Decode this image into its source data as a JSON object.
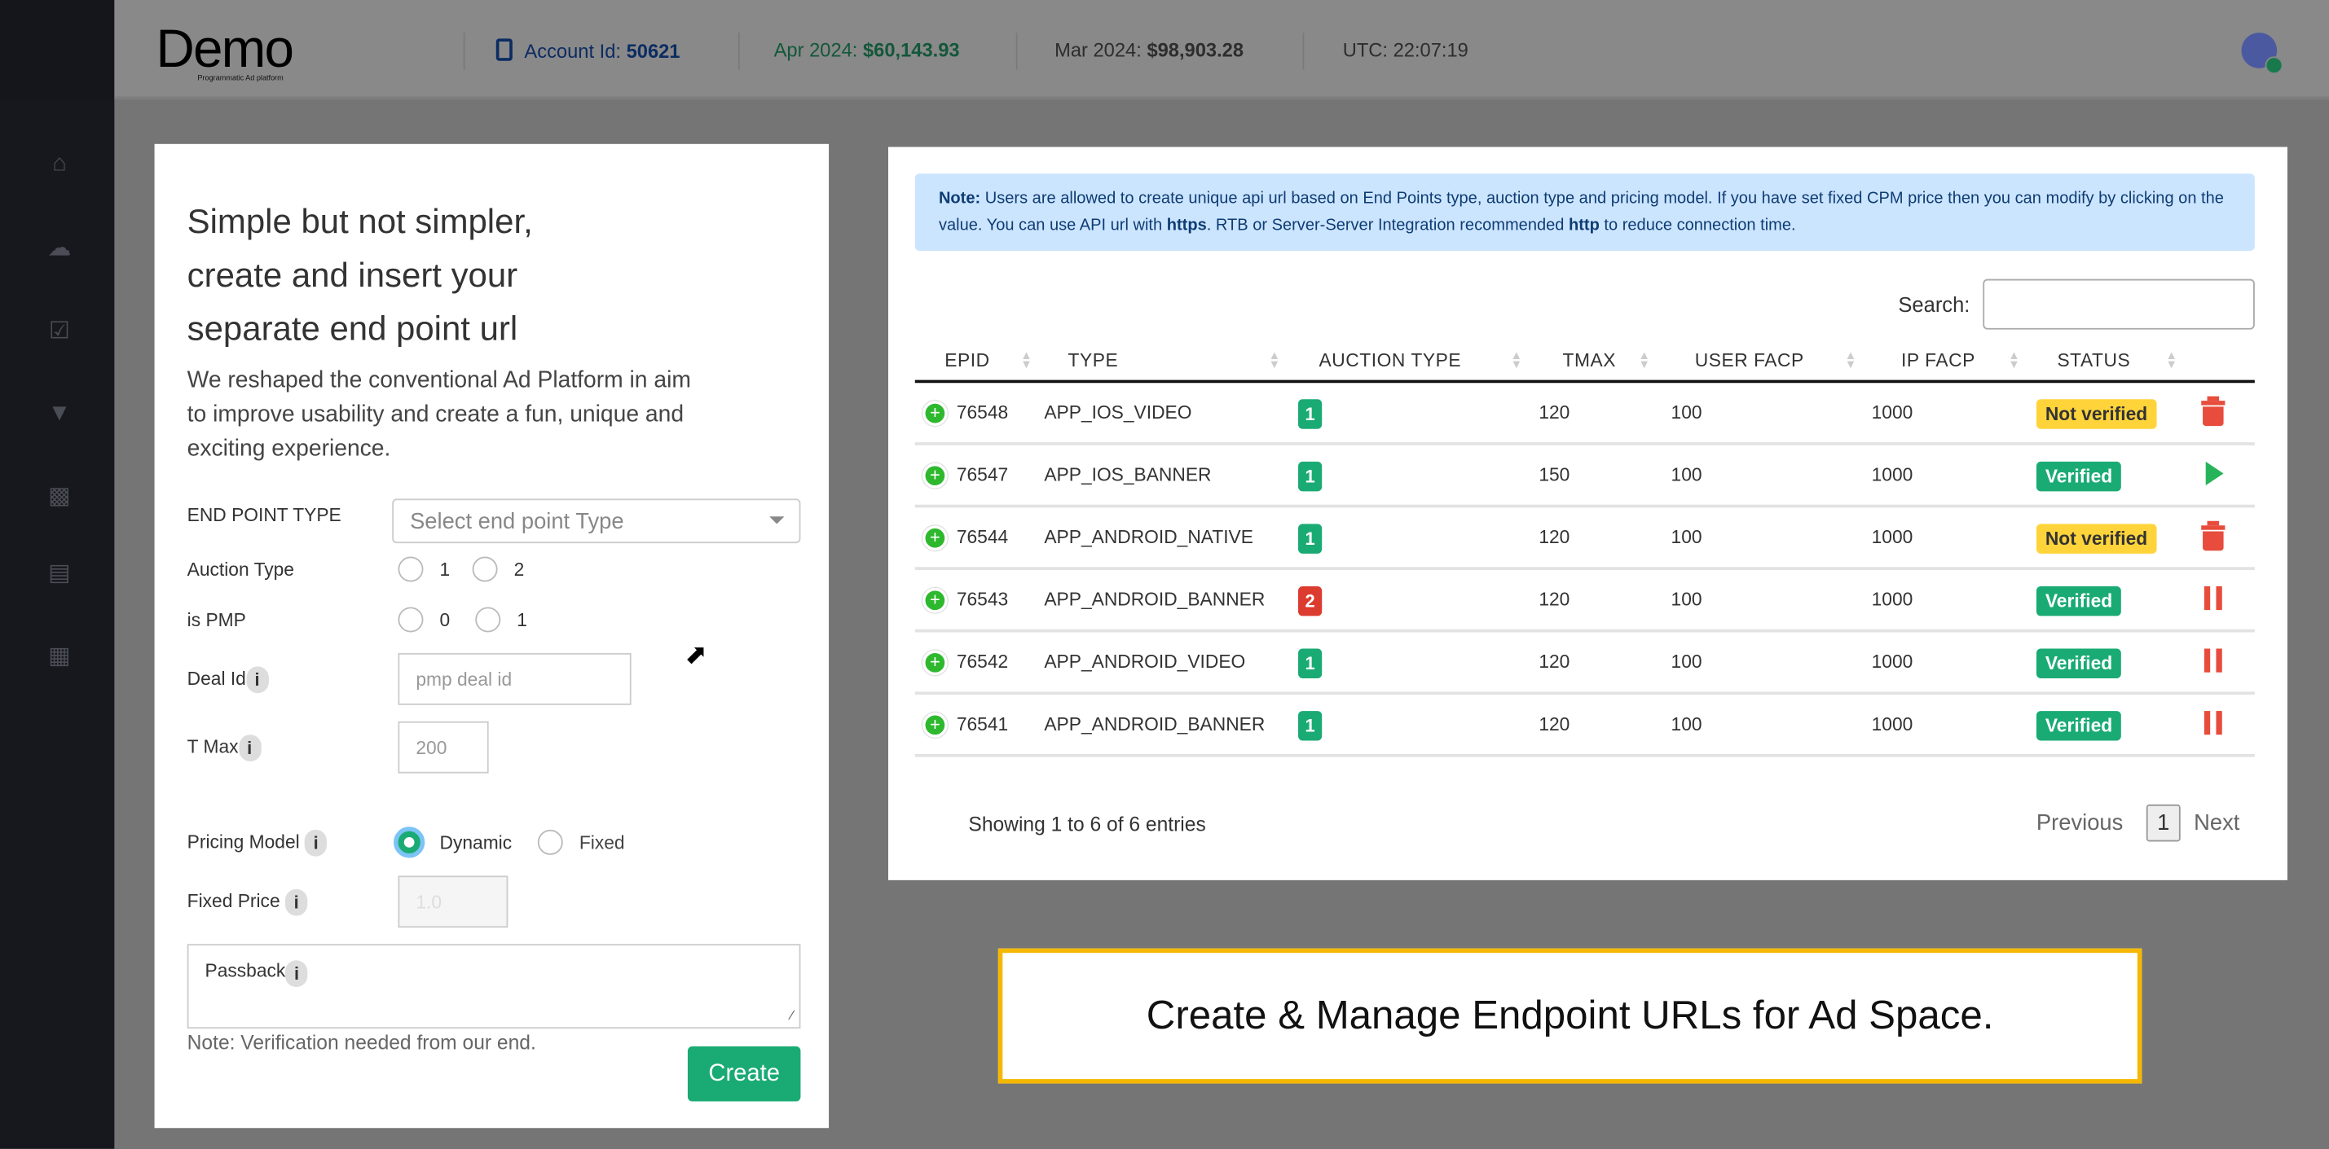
{
  "header": {
    "logo": "Demo",
    "logo_sub": "Programmatic Ad platform",
    "account_label": "Account Id:",
    "account_id": "50621",
    "apr_label": "Apr 2024:",
    "apr_value": "$60,143.93",
    "mar_label": "Mar 2024:",
    "mar_value": "$98,903.28",
    "utc": "UTC: 22:07:19"
  },
  "sidebar": {
    "items": [
      "home",
      "cloud",
      "calendar-check",
      "filter",
      "bar-chart",
      "credit-card",
      "building-add"
    ]
  },
  "form": {
    "heading": "Simple but not simpler, create and insert your separate end point url",
    "intro": "We reshaped the conventional Ad Platform in aim to improve usability and create a fun, unique and exciting experience.",
    "endpoint_label": "END POINT TYPE",
    "endpoint_placeholder": "Select end point Type",
    "auction_label": "Auction Type",
    "auction_options": [
      "1",
      "2"
    ],
    "pmp_label": "is PMP",
    "pmp_options": [
      "0",
      "1"
    ],
    "deal_label": "Deal Id",
    "deal_placeholder": "pmp deal id",
    "tmax_label": "T Max",
    "tmax_placeholder": "200",
    "pricing_label": "Pricing Model",
    "pricing_options": [
      "Dynamic",
      "Fixed"
    ],
    "pricing_selected": "Dynamic",
    "fixed_label": "Fixed Price",
    "fixed_placeholder": "1.0",
    "passback_label": "Passback",
    "info": "i",
    "note": "Note: Verification needed from our end.",
    "create": "Create"
  },
  "table": {
    "note_bold": "Note:",
    "note_1": " Users are allowed to create unique api url based on End Points type, auction type and pricing model. If you have set fixed CPM price then you can modify by clicking on the value. You can use API url with ",
    "note_https": "https",
    "note_2": ". RTB or Server-Server Integration recommended ",
    "note_http": "http",
    "note_3": " to reduce connection time.",
    "search_label": "Search:",
    "columns": [
      "EPID",
      "TYPE",
      "AUCTION TYPE",
      "TMAX",
      "USER FACP",
      "IP FACP",
      "STATUS"
    ],
    "rows": [
      {
        "epid": "76548",
        "type": "APP_IOS_VIDEO",
        "auction": "1",
        "tmax": "120",
        "user": "100",
        "ip": "1000",
        "status": "Not verified",
        "action": "trash"
      },
      {
        "epid": "76547",
        "type": "APP_IOS_BANNER",
        "auction": "1",
        "tmax": "150",
        "user": "100",
        "ip": "1000",
        "status": "Verified",
        "action": "play"
      },
      {
        "epid": "76544",
        "type": "APP_ANDROID_NATIVE",
        "auction": "1",
        "tmax": "120",
        "user": "100",
        "ip": "1000",
        "status": "Not verified",
        "action": "trash"
      },
      {
        "epid": "76543",
        "type": "APP_ANDROID_BANNER",
        "auction": "2",
        "tmax": "120",
        "user": "100",
        "ip": "1000",
        "status": "Verified",
        "action": "pause"
      },
      {
        "epid": "76542",
        "type": "APP_ANDROID_VIDEO",
        "auction": "1",
        "tmax": "120",
        "user": "100",
        "ip": "1000",
        "status": "Verified",
        "action": "pause"
      },
      {
        "epid": "76541",
        "type": "APP_ANDROID_BANNER",
        "auction": "1",
        "tmax": "120",
        "user": "100",
        "ip": "1000",
        "status": "Verified",
        "action": "pause"
      }
    ],
    "showing": "Showing 1 to 6 of 6 entries",
    "previous": "Previous",
    "page": "1",
    "next": "Next"
  },
  "caption": "Create & Manage Endpoint URLs for Ad Space.",
  "colors": {
    "green": "#1aab74",
    "yellow": "#ffd43b",
    "red": "#e74c3c",
    "note_bg": "#cce5ff"
  }
}
